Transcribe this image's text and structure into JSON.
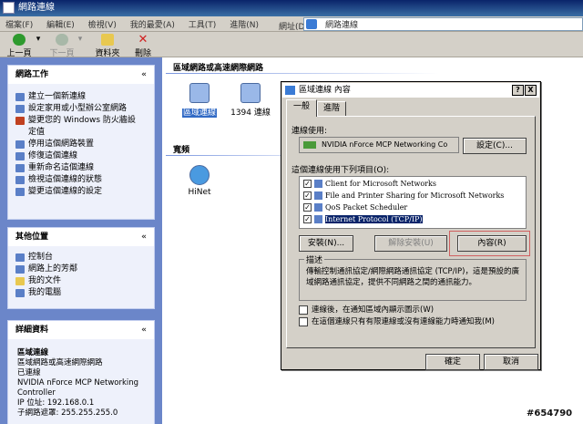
{
  "window": {
    "title": "網路連線"
  },
  "menubar": {
    "items": [
      "檔案(F)",
      "編輯(E)",
      "檢視(V)",
      "我的最愛(A)",
      "工具(T)",
      "進階(N)"
    ],
    "address_label": "網址(D)",
    "address_value": "網路連線"
  },
  "toolbar": {
    "back": "上一頁",
    "forward": "下一頁",
    "folders": "資料夾",
    "delete": "刪除"
  },
  "sidebar": {
    "network_tasks": {
      "title": "網路工作",
      "items": [
        "建立一個新連線",
        "設定家用或小型辦公室網路",
        "變更您的 Windows 防火牆設",
        "定值",
        "停用這個網路裝置",
        "修復這個連線",
        "重新命名這個連線",
        "檢視這個連線的狀態",
        "變更這個連線的設定"
      ]
    },
    "other_places": {
      "title": "其他位置",
      "items": [
        "控制台",
        "網路上的芳鄰",
        "我的文件",
        "我的電腦"
      ]
    },
    "details": {
      "title": "詳細資料",
      "name": "區域連線",
      "lines": [
        "區域網路或高速網際網路",
        "已連線",
        "NVIDIA nForce MCP Networking",
        "Controller",
        "IP 位址: 192.168.0.1",
        "子網路遮罩: 255.255.255.0"
      ]
    }
  },
  "main": {
    "section_lan": "區域網路或高速網際網路",
    "connections": [
      {
        "label": "區域連線"
      },
      {
        "label": "1394 連線"
      }
    ],
    "section_wizard": "寬頻",
    "wizard_item": {
      "label": "HiNet"
    }
  },
  "dialog": {
    "title": "區域連線 內容",
    "help_btn": "?",
    "close_btn": "X",
    "tabs": [
      "一般",
      "進階"
    ],
    "connect_using_label": "連線使用:",
    "adapter_name": "NVIDIA nForce MCP Networking Co",
    "configure_btn": "設定(C)...",
    "components_label": "這個連線使用下列項目(O):",
    "components": [
      {
        "name": "Client for Microsoft Networks",
        "checked": true
      },
      {
        "name": "File and Printer Sharing for Microsoft Networks",
        "checked": true
      },
      {
        "name": "QoS Packet Scheduler",
        "checked": true
      },
      {
        "name": "Internet Protocol (TCP/IP)",
        "checked": true
      }
    ],
    "install_btn": "安裝(N)...",
    "uninstall_btn": "解除安裝(U)",
    "properties_btn": "內容(R)",
    "description_label": "描述",
    "description_text": "傳輸控制通訊協定/網際網路通訊協定 (TCP/IP)，這是預設的廣域網路通訊協定，提供不同網路之間的通訊能力。",
    "show_icon_label": "連線後，在通知區域內顯示圖示(W)",
    "notify_label": "在這個連線只有有限連線或沒有連線能力時通知我(M)",
    "ok_btn": "確定",
    "cancel_btn": "取消"
  },
  "watermark": "#654790"
}
